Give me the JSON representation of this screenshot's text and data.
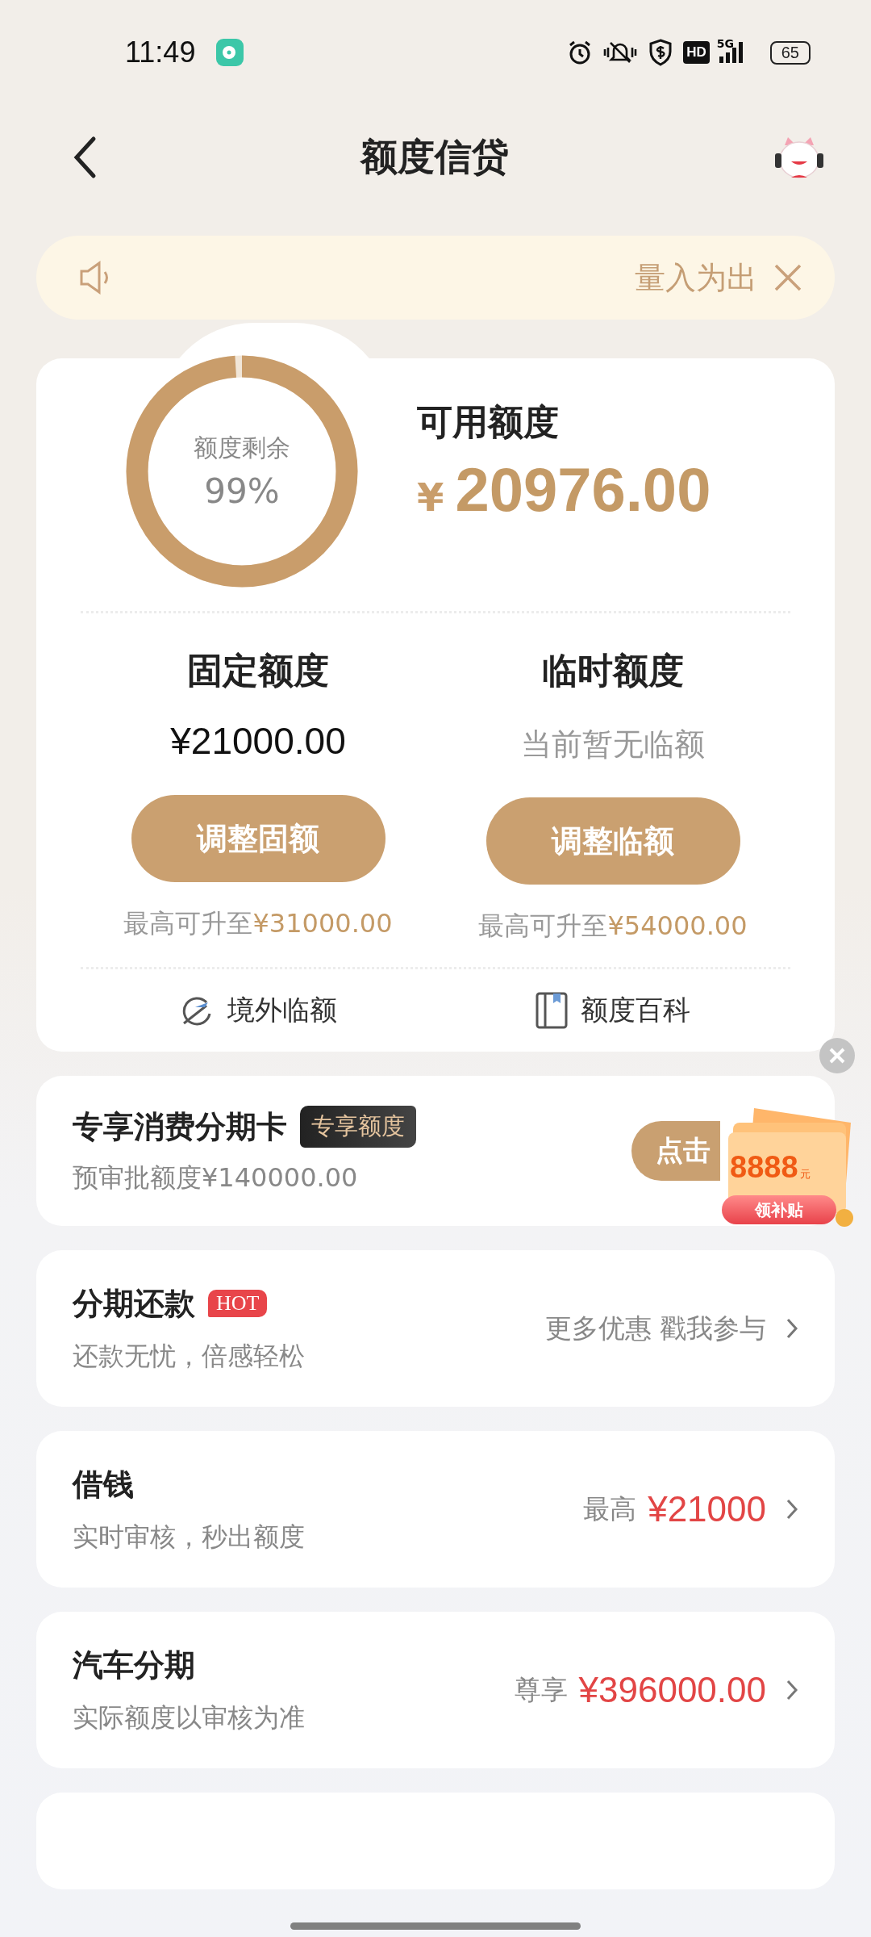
{
  "status_bar": {
    "time": "11:49",
    "hd_label": "HD",
    "network": "5G",
    "battery": "65"
  },
  "header": {
    "title": "额度信贷"
  },
  "notice": {
    "text": "量入为出"
  },
  "quota_card": {
    "ring_label": "额度剩余",
    "ring_percent": "99%",
    "level": 0.99,
    "available_label": "可用额度",
    "currency": "¥",
    "available_amount": "20976.00",
    "columns": [
      {
        "title": "固定额度",
        "kind": "amount",
        "value": "¥21000.00",
        "button": "调整固额",
        "hint_prefix": "最高可升至",
        "hint_amount": "¥31000.00"
      },
      {
        "title": "临时额度",
        "kind": "empty",
        "value": "当前暂无临额",
        "button": "调整临额",
        "hint_prefix": "最高可升至",
        "hint_amount": "¥54000.00"
      }
    ],
    "links": [
      {
        "label": "境外临额",
        "kind": "travel"
      },
      {
        "label": "额度百科",
        "kind": "book"
      }
    ]
  },
  "promo": {
    "title": "专享消费分期卡",
    "badge": "专享额度",
    "subtitle": "预审批额度¥140000.00",
    "button": "点击",
    "sticker": {
      "amount": "8888",
      "unit": "元",
      "button": "领补贴"
    }
  },
  "services": [
    {
      "title": "分期还款",
      "badge": "HOT",
      "subtitle": "还款无忧，倍感轻松",
      "kind": "promo",
      "right_text": "更多优惠 戳我参与"
    },
    {
      "title": "借钱",
      "subtitle": "实时审核，秒出额度",
      "kind": "amount",
      "right_prefix": "最高",
      "right_value": "¥21000"
    },
    {
      "title": "汽车分期",
      "subtitle": "实际额度以审核为准",
      "kind": "amount",
      "right_prefix": "尊享",
      "right_value": "¥396000.00"
    }
  ]
}
